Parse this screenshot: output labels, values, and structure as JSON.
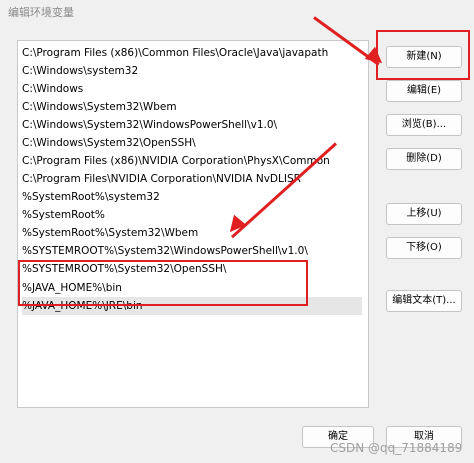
{
  "window": {
    "title": "编辑环境变量"
  },
  "paths": [
    "C:\\Program Files (x86)\\Common Files\\Oracle\\Java\\javapath",
    "C:\\Windows\\system32",
    "C:\\Windows",
    "C:\\Windows\\System32\\Wbem",
    "C:\\Windows\\System32\\WindowsPowerShell\\v1.0\\",
    "C:\\Windows\\System32\\OpenSSH\\",
    "C:\\Program Files (x86)\\NVIDIA Corporation\\PhysX\\Common",
    "C:\\Program Files\\NVIDIA Corporation\\NVIDIA NvDLISR",
    "%SystemRoot%\\system32",
    "%SystemRoot%",
    "%SystemRoot%\\System32\\Wbem",
    "%SYSTEMROOT%\\System32\\WindowsPowerShell\\v1.0\\",
    "%SYSTEMROOT%\\System32\\OpenSSH\\",
    "%JAVA_HOME%\\bin",
    "%JAVA_HOME%\\JRE\\bin"
  ],
  "buttons": {
    "new": "新建(N)",
    "edit": "编辑(E)",
    "browse": "浏览(B)...",
    "delete": "删除(D)",
    "up": "上移(U)",
    "down": "下移(O)",
    "edit_text": "编辑文本(T)...",
    "ok": "确定",
    "cancel": "取消"
  },
  "watermark": "CSDN @qq_71884189",
  "colors": {
    "annotation": "#e02020"
  }
}
